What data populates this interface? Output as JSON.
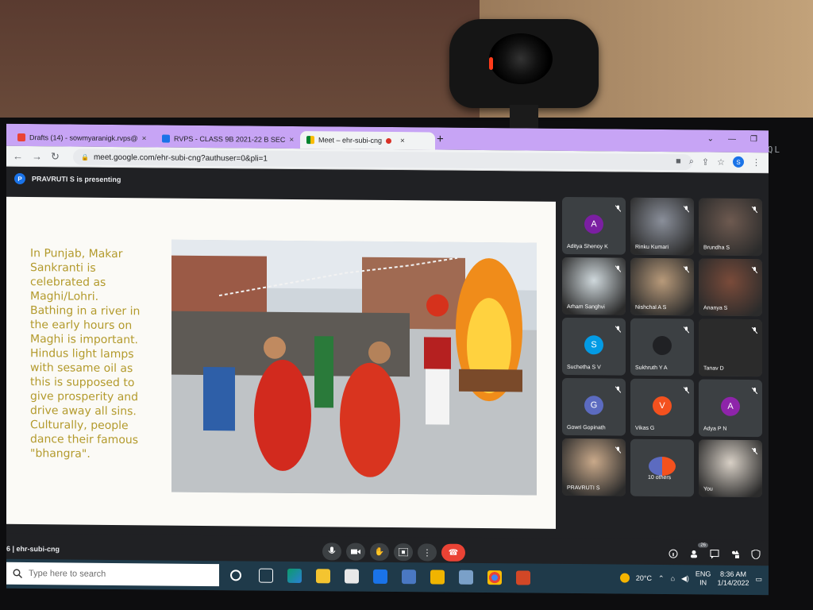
{
  "browser": {
    "tabs": [
      {
        "label": "Drafts (14) - sowmyaranigk.rvps@",
        "close": "×"
      },
      {
        "label": "RVPS - CLASS 9B 2021-22 B SEC",
        "close": "×"
      },
      {
        "label": "Meet – ehr-subi-cng",
        "close": "×"
      }
    ],
    "new_tab": "+",
    "window_controls": [
      "⌄",
      "—",
      "❐"
    ],
    "url": "meet.google.com/ehr-subi-cng?authuser=0&pli=1",
    "profile_initial": "S"
  },
  "meet": {
    "presenter_initial": "P",
    "presenting_text": "PRAVRUTI S is presenting",
    "meeting_code": "ehr-subi-cng",
    "code_prefix": "6  |",
    "participants_count": "26",
    "slide": {
      "text_lines": [
        "In Punjab, Makar",
        "Sankranti is",
        "celebrated as",
        "Maghi/Lohri.",
        "Bathing in a river in",
        "the early hours on",
        "Maghi is important.",
        "Hindus light lamps",
        "with sesame oil as",
        "this is supposed to",
        "give prosperity and",
        "drive away all sins.",
        "Culturally, people",
        "dance their famous",
        "\"bhangra\"."
      ]
    },
    "participants": [
      {
        "name": "Aditya Shenoy K",
        "initial": "A",
        "color": "#7b1fa2",
        "type": "avatar"
      },
      {
        "name": "Rinku Kumari",
        "initial": "",
        "color": "#8a8f9a",
        "type": "camera"
      },
      {
        "name": "Brundha S",
        "initial": "",
        "color": "#6e5a50",
        "type": "camera"
      },
      {
        "name": "Arham Sanghvi",
        "initial": "",
        "color": "#cfd8dc",
        "type": "photo"
      },
      {
        "name": "Nishchal A S",
        "initial": "",
        "color": "#b89a7a",
        "type": "camera"
      },
      {
        "name": "Ananya S",
        "initial": "",
        "color": "#7a4b3a",
        "type": "camera"
      },
      {
        "name": "Suchetha S V",
        "initial": "S",
        "color": "#039be5",
        "type": "avatar"
      },
      {
        "name": "Sukhruth Y A",
        "initial": "",
        "color": "#202124",
        "type": "avatar"
      },
      {
        "name": "Tanav D",
        "initial": "",
        "color": "#2b2b2b",
        "type": "photo"
      },
      {
        "name": "Gowri Gopinath",
        "initial": "G",
        "color": "#5c6bc0",
        "type": "avatar"
      },
      {
        "name": "Vikas G",
        "initial": "V",
        "color": "#f4511e",
        "type": "avatar"
      },
      {
        "name": "Adya P N",
        "initial": "A",
        "color": "#8e24aa",
        "type": "avatar"
      },
      {
        "name": "PRAVRUTI S",
        "initial": "",
        "color": "#c9a98a",
        "type": "camera"
      },
      {
        "name": "10 others",
        "initial": "",
        "color": "#3c4043",
        "type": "others"
      },
      {
        "name": "You",
        "initial": "",
        "color": "#d8d0c6",
        "type": "camera"
      }
    ]
  },
  "taskbar": {
    "search_placeholder": "Type here to search",
    "weather": "20°C",
    "language": "ENG",
    "language_sub": "IN",
    "time": "8:36 AM",
    "date": "1/14/2022"
  },
  "colors": {
    "tabbar": "#c7a4f5",
    "slide_text": "#b39a2c",
    "end_call": "#ea4335",
    "meet_bg": "#202124"
  }
}
